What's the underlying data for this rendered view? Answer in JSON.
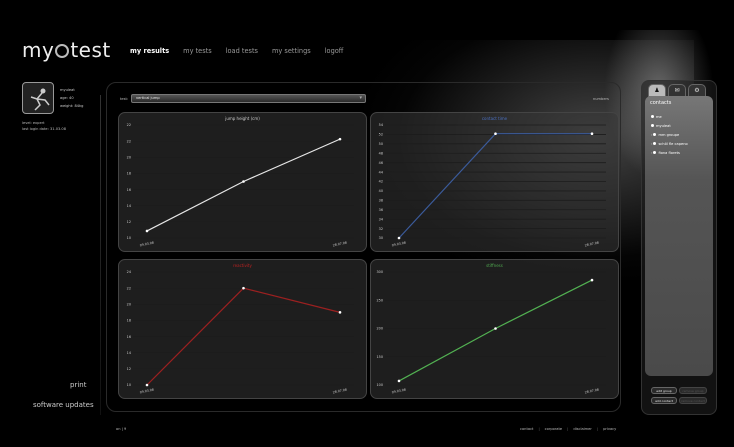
{
  "app": {
    "logo": "myotest"
  },
  "nav": [
    {
      "label": "my results",
      "active": true
    },
    {
      "label": "my tests",
      "active": false
    },
    {
      "label": "load tests",
      "active": false
    },
    {
      "label": "my settings",
      "active": false
    },
    {
      "label": "logoff",
      "active": false
    }
  ],
  "profile": {
    "name": "myuleat",
    "age": "age: 40",
    "weight": "weight: 84kg",
    "level": "level: expert",
    "last_login": "last login date: 31.03.08"
  },
  "sidebar": {
    "print": "print",
    "software_updates": "software updates"
  },
  "toolbar": {
    "test_label": "test:",
    "selected_test": "vertical jump",
    "numbers_label": "numbers"
  },
  "charts": [
    {
      "title": "jump height (cm)",
      "title_color": "#cccccc",
      "line_color": "#e6e6e6",
      "ticks": [
        "22",
        "22",
        "20",
        "18",
        "16",
        "14",
        "12",
        "10"
      ]
    },
    {
      "title": "contact time",
      "title_color": "#4a6fbf",
      "line_color": "#3b5b9b",
      "ticks": [
        "54",
        "52",
        "50",
        "48",
        "46",
        "44",
        "42",
        "40",
        "38",
        "36",
        "34",
        "32",
        "30"
      ]
    },
    {
      "title": "reactivity",
      "title_color": "#bb2222",
      "line_color": "#9b2020",
      "ticks": [
        "24",
        "22",
        "20",
        "18",
        "16",
        "14",
        "12",
        "10"
      ]
    },
    {
      "title": "stiffness",
      "title_color": "#4fa84f",
      "line_color": "#52b152",
      "ticks": [
        "300",
        "250",
        "200",
        "150",
        "100"
      ]
    }
  ],
  "chart_data": [
    {
      "type": "line",
      "x": [
        "09.03.08",
        "",
        "28.07.08"
      ],
      "values": [
        11,
        18,
        24
      ],
      "ylim": [
        10,
        26
      ]
    },
    {
      "type": "line",
      "x": [
        "09.03.08",
        "",
        "28.07.08"
      ],
      "values": [
        30,
        54,
        54
      ],
      "ylim": [
        30,
        56
      ]
    },
    {
      "type": "line",
      "x": [
        "09.03.08",
        "",
        "28.07.08"
      ],
      "values": [
        10,
        22,
        19
      ],
      "ylim": [
        10,
        24
      ]
    },
    {
      "type": "line",
      "x": [
        "09.03.08",
        "",
        "28.07.08"
      ],
      "values": [
        110,
        240,
        360
      ],
      "ylim": [
        100,
        380
      ]
    }
  ],
  "bottom": {
    "left": "on | 9"
  },
  "footer": {
    "contact": "contact",
    "corporate": "corporate",
    "disclaimer": "disclaimer",
    "privacy": "privacy"
  },
  "contacts": {
    "header": "contacts",
    "items": [
      "me",
      "myuleat",
      "mm groupe",
      "schöl fle capeno",
      "fiona florets"
    ],
    "buttons": {
      "edit_group": "edit group",
      "remove_group": "remove group",
      "add_contact": "add contact",
      "remove_contact": "remove contact"
    }
  }
}
